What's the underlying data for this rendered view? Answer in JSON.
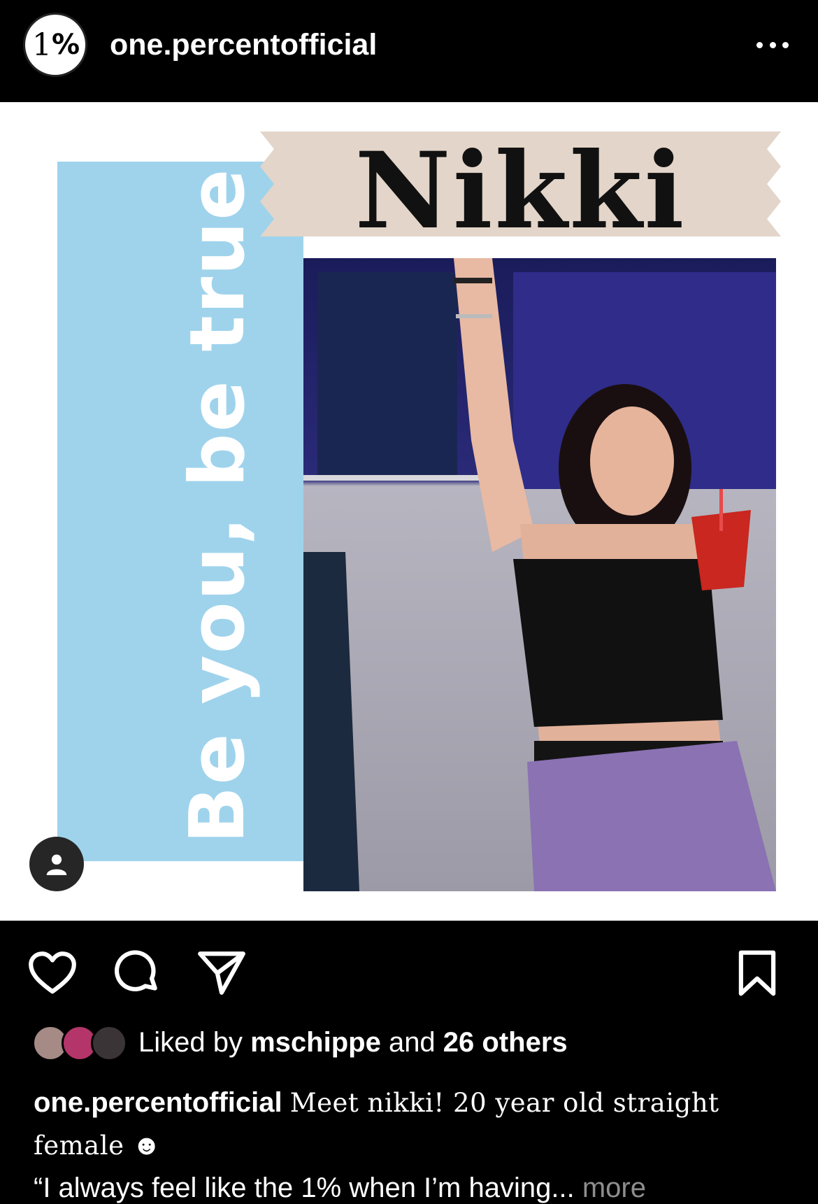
{
  "header": {
    "avatar_text_one": "1",
    "avatar_text_percent": "%",
    "username": "one.percentofficial"
  },
  "post_image": {
    "vertical_slogan": "Be you, be true",
    "banner_name": "Nikki"
  },
  "likes": {
    "prefix": "Liked by ",
    "user": "mschippe",
    "middle": " and ",
    "others": "26 others"
  },
  "caption": {
    "username": "one.percentofficial",
    "text": "Meet nikki! 20 year old straight female",
    "emoji": "☻",
    "quote": "“I always feel like the 1% when I’m having...",
    "more": "more"
  },
  "colors": {
    "background": "#000000",
    "panel_blue": "#9fd3ec",
    "banner_beige": "#e3d5c9",
    "muted": "#8e8e8e"
  }
}
